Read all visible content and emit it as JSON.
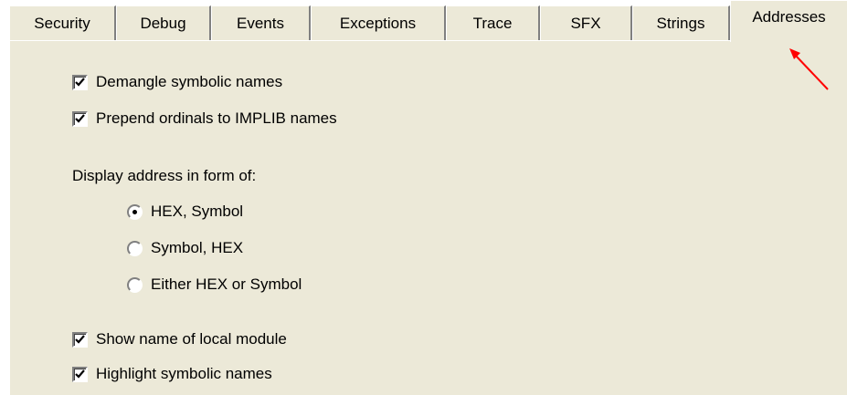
{
  "tabs": [
    {
      "label": "Security",
      "active": false
    },
    {
      "label": "Debug",
      "active": false
    },
    {
      "label": "Events",
      "active": false
    },
    {
      "label": "Exceptions",
      "active": false
    },
    {
      "label": "Trace",
      "active": false
    },
    {
      "label": "SFX",
      "active": false
    },
    {
      "label": "Strings",
      "active": false
    },
    {
      "label": "Addresses",
      "active": true
    }
  ],
  "options": {
    "demangle": {
      "label": "Demangle symbolic names",
      "checked": true
    },
    "prepend": {
      "label": "Prepend ordinals to IMPLIB names",
      "checked": true
    },
    "show_local": {
      "label": "Show name of local module",
      "checked": true
    },
    "highlight": {
      "label": "Highlight symbolic names",
      "checked": true
    }
  },
  "address_group": {
    "label": "Display address in form of:",
    "choices": [
      {
        "label": "HEX, Symbol",
        "selected": true
      },
      {
        "label": "Symbol, HEX",
        "selected": false
      },
      {
        "label": "Either HEX or Symbol",
        "selected": false
      }
    ]
  },
  "colors": {
    "panel": "#ECE9D8",
    "arrow": "#FF0000"
  },
  "annotation": {
    "icon": "red-arrow-icon",
    "points_to": "Addresses"
  }
}
